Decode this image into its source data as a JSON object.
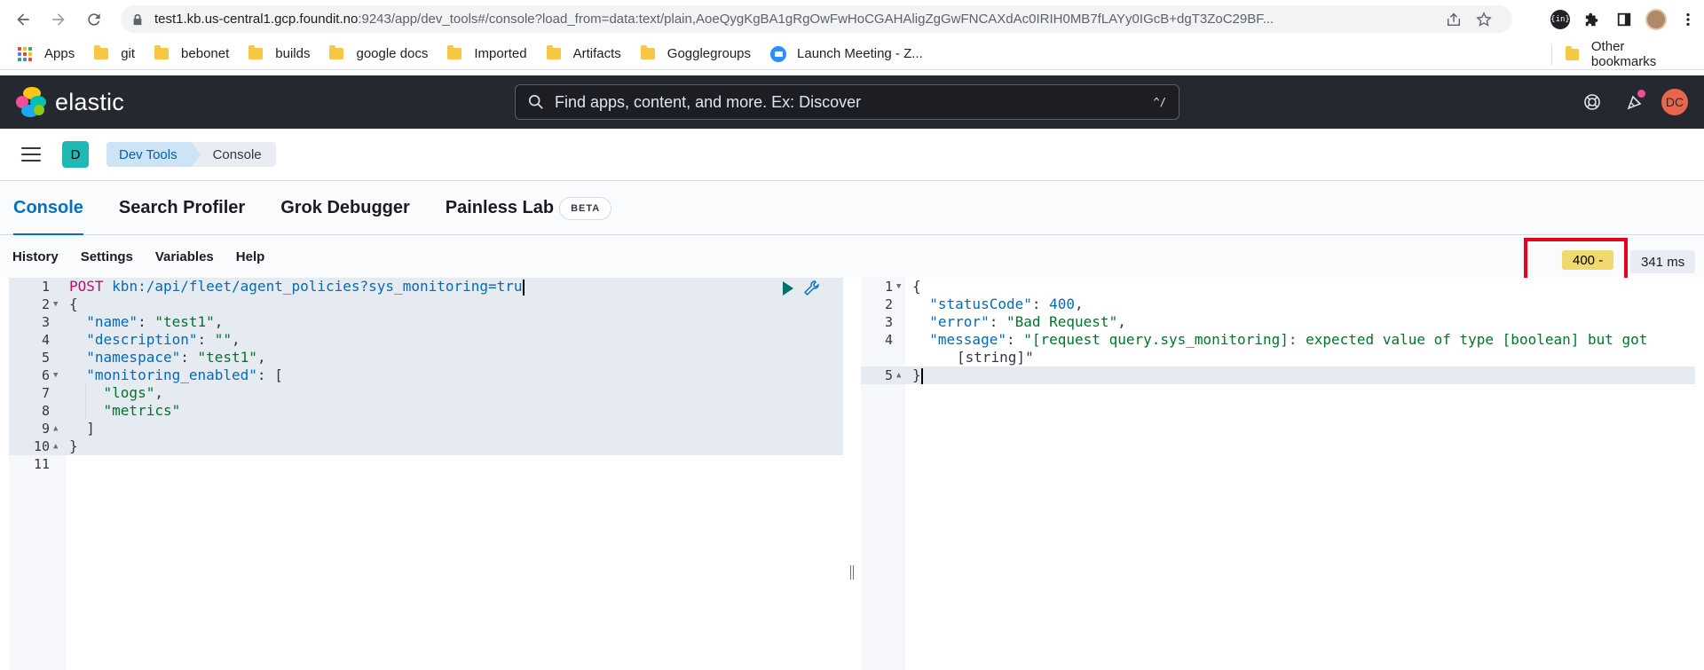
{
  "browser": {
    "url_host": "test1.kb.us-central1.gcp.foundit.no",
    "url_rest": ":9243/app/dev_tools#/console?load_from=data:text/plain,AoeQygKgBA1gRgOwFwHoCGAHAligZgGwFNCAXdAc0IRIH0MB7fLAYy0IGcB+dgT3ZoC29BF...",
    "extension_badge": "{in}"
  },
  "bookmarks": {
    "apps": "Apps",
    "items": [
      "git",
      "bebonet",
      "builds",
      "google docs",
      "Imported",
      "Artifacts",
      "Gogglegroups"
    ],
    "zoom": "Launch Meeting - Z...",
    "other": "Other bookmarks"
  },
  "elastic": {
    "brand": "elastic",
    "search_placeholder": "Find apps, content, and more. Ex: Discover",
    "search_shortcut": "^/",
    "user_initials": "DC",
    "space_initial": "D"
  },
  "breadcrumbs": [
    "Dev Tools",
    "Console"
  ],
  "tabs": [
    {
      "label": "Console",
      "active": true
    },
    {
      "label": "Search Profiler",
      "active": false
    },
    {
      "label": "Grok Debugger",
      "active": false
    },
    {
      "label": "Painless Lab",
      "active": false,
      "badge": "BETA"
    }
  ],
  "console_menu": [
    "History",
    "Settings",
    "Variables",
    "Help"
  ],
  "response_status": {
    "code": "400 -",
    "time": "341 ms"
  },
  "colors": {
    "header_bg": "#25282f",
    "accent": "#0071c2",
    "status_warning": "#f1d86f",
    "highlight": "#e3051b"
  },
  "request_editor": {
    "method": "POST",
    "url": "kbn:/api/fleet/agent_policies?sys_monitoring=tru",
    "lines": [
      {
        "n": "1"
      },
      {
        "n": "2",
        "t": "{"
      },
      {
        "n": "3",
        "k": "\"name\"",
        "v": "\"test1\"",
        "e": ","
      },
      {
        "n": "4",
        "k": "\"description\"",
        "v": "\"\"",
        "e": ","
      },
      {
        "n": "5",
        "k": "\"namespace\"",
        "v": "\"test1\"",
        "e": ","
      },
      {
        "n": "6",
        "k": "\"monitoring_enabled\"",
        "e": ": ["
      },
      {
        "n": "7",
        "v": "\"logs\"",
        "e": ","
      },
      {
        "n": "8",
        "v": "\"metrics\""
      },
      {
        "n": "9",
        "t": "  ]"
      },
      {
        "n": "10",
        "t": "}"
      },
      {
        "n": "11",
        "t": ""
      }
    ]
  },
  "response_editor": {
    "lines": [
      {
        "n": "1",
        "t": "{"
      },
      {
        "n": "2",
        "k": "\"statusCode\"",
        "v": "400",
        "e": ","
      },
      {
        "n": "3",
        "k": "\"error\"",
        "v": "\"Bad Request\"",
        "e": ","
      },
      {
        "n": "4",
        "k": "\"message\"",
        "v": "\"[request query.sys_monitoring]: expected value of type [boolean] but got",
        "v2": "[string]\""
      },
      {
        "n": "5",
        "t": "}"
      }
    ]
  }
}
